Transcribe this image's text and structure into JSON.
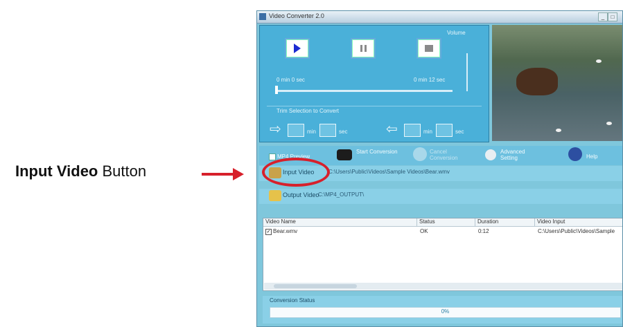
{
  "annotation": {
    "bold": "Input Video",
    "rest": "Button"
  },
  "window": {
    "title": "Video Converter 2.0"
  },
  "player": {
    "time_left": "0 min 0 sec",
    "time_right": "0 min 12 sec",
    "volume_label": "Volume",
    "trim_label": "Trim Selection to Convert",
    "start_unit_min": "min",
    "start_unit_sec": "sec",
    "end_unit_min": "min",
    "end_unit_sec": "sec"
  },
  "toolbar": {
    "mp4_preview": "MP4 Preview",
    "start_conversion": "Start Conversion",
    "cancel_conversion": "Cancel Conversion",
    "advanced_setting": "Advanced Setting",
    "help": "Help"
  },
  "input_row": {
    "label": "Input Video",
    "path": "C:\\Users\\Public\\Videos\\Sample Videos\\Bear.wmv"
  },
  "output_row": {
    "label": "Output Video",
    "path": "C:\\MP4_OUTPUT\\"
  },
  "table": {
    "headers": [
      "Video Name",
      "Status",
      "Duration",
      "Video Input"
    ],
    "rows": [
      {
        "name": "Bear.wmv",
        "status": "OK",
        "duration": "0:12",
        "input": "C:\\Users\\Public\\Videos\\Sample"
      }
    ]
  },
  "status": {
    "label": "Conversion Status",
    "progress_text": "0%"
  },
  "colors": {
    "accent": "#4ab0d9",
    "annotation": "#d7202b"
  }
}
